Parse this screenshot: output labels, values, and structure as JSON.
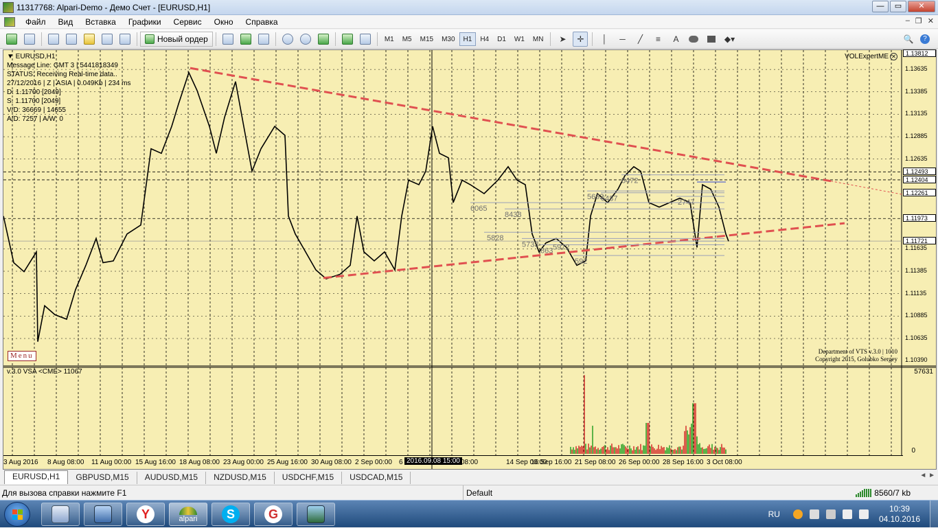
{
  "window": {
    "title": "11317768: Alpari-Demo - Демо Счет - [EURUSD,H1]",
    "min_label": "—",
    "max_label": "▭",
    "close_label": "✕"
  },
  "menu": {
    "items": [
      "Файл",
      "Вид",
      "Вставка",
      "Графики",
      "Сервис",
      "Окно",
      "Справка"
    ],
    "mdi_min": "–",
    "mdi_restore": "❐",
    "mdi_close": "✕"
  },
  "toolbar": {
    "new_order_label": "Новый ордер",
    "timeframes": [
      "M1",
      "M5",
      "M15",
      "M30",
      "H1",
      "H4",
      "D1",
      "W1",
      "MN"
    ],
    "active_timeframe": "H1",
    "text_tool_label": "A"
  },
  "chart": {
    "symbol_label": "▼ EURUSD,H1",
    "info_lines": [
      "Message Line: GMT 3  |  5441818349",
      "STATUS:  Receiving Real-time data..",
      "27/12/2016 | Z | ASIA | 0.049Kb | 234 ms",
      "D: 1.11700  [2049]",
      "S: 1.11700  [2049]",
      "V/D: 36669  |  14655",
      "A/D: 7257  |  A/W: 0"
    ],
    "indicator_name": "VOLExpertME",
    "copyright_line1": "Department of VTS  v.3.0 | 1010",
    "copyright_line2": "Copyright 2015, Golubko Sergey",
    "menu_button": "Menu",
    "subwindow_label": "v.3.0 VSA <CME> 11067",
    "subwindow_max": "57631",
    "subwindow_zero": "0",
    "price_ticks": [
      "1.13812",
      "1.13635",
      "1.13385",
      "1.13135",
      "1.12885",
      "1.12635",
      "1.12493",
      "1.12404",
      "1.12261",
      "1.11973",
      "1.11721",
      "1.11635",
      "1.11385",
      "1.11135",
      "1.10885",
      "1.10635",
      "1.10390"
    ],
    "boxed_prices": [
      "1.13812",
      "1.12493",
      "1.12404",
      "1.12261",
      "1.11973",
      "1.11721"
    ],
    "time_ticks": [
      "3 Aug 2016",
      "8 Aug 08:00",
      "11 Aug 00:00",
      "15 Aug 16:00",
      "18 Aug 08:00",
      "23 Aug 00:00",
      "25 Aug 16:00",
      "30 Aug 08:00",
      "2 Sep 00:00",
      "6",
      "08:00",
      "14 Sep 00:00",
      "16 Sep 16:00",
      "21 Sep 08:00",
      "26 Sep 00:00",
      "28 Sep 16:00",
      "3 Oct 08:00"
    ],
    "time_cursor": "2016.09.08 15:00",
    "volume_levels": [
      "6065",
      "8438",
      "5828",
      "5733",
      "863",
      "5972",
      "592",
      "6487",
      "5692",
      "2747",
      "8472"
    ]
  },
  "tabs": {
    "items": [
      "EURUSD,H1",
      "GBPUSD,M15",
      "AUDUSD,M15",
      "NZDUSD,M15",
      "USDCHF,M15",
      "USDCAD,M15"
    ],
    "active": "EURUSD,H1",
    "scroll_arrows": "◄ ►"
  },
  "status": {
    "help_text": "Для вызова справки нажмите F1",
    "profile": "Default",
    "traffic": "8560/7 kb"
  },
  "taskbar": {
    "apps": [
      "calculator",
      "computer",
      "yandex",
      "alpari",
      "skype",
      "g-app",
      "photos"
    ],
    "alpari_label": "alpari",
    "yandex_label": "Y",
    "skype_label": "S",
    "g_label": "G",
    "lang": "RU",
    "time": "10:39",
    "date": "04.10.2016"
  },
  "colors": {
    "chart_bg": "#f7eeb3",
    "trendline": "#e05050",
    "candle": "#000000",
    "volume_up": "#1a9a1a",
    "volume_down": "#d02020"
  }
}
